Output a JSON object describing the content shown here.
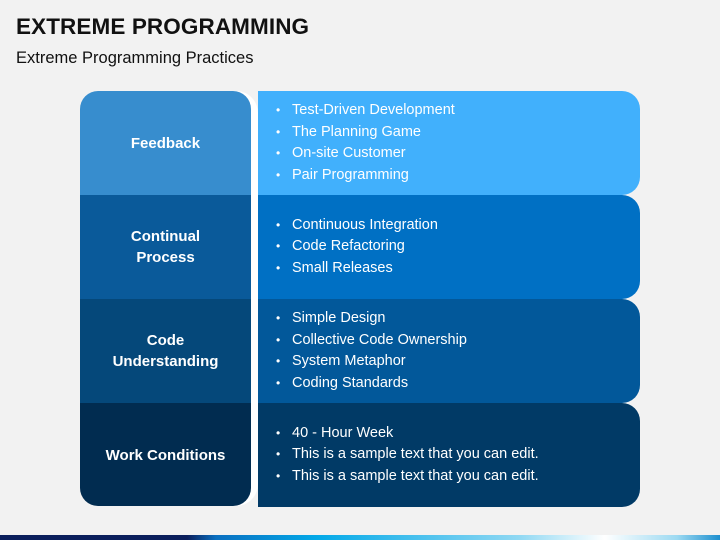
{
  "header": {
    "title": "EXTREME PROGRAMMING",
    "subtitle": "Extreme Programming Practices"
  },
  "rows": [
    {
      "label": "Feedback",
      "left_color": "#378dce",
      "right_color": "#41b0fc",
      "items": [
        "Test-Driven Development",
        "The Planning Game",
        "On-site Customer",
        "Pair Programming"
      ]
    },
    {
      "label": "Continual Process",
      "left_color": "#0a5a9a",
      "right_color": "#0070c4",
      "items": [
        "Continuous Integration",
        "Code Refactoring",
        "Small Releases"
      ]
    },
    {
      "label": "Code Understanding",
      "left_color": "#05487a",
      "right_color": "#02589a",
      "items": [
        "Simple Design",
        "Collective Code Ownership",
        "System Metaphor",
        "Coding Standards"
      ]
    },
    {
      "label": "Work Conditions",
      "left_color": "#012c50",
      "right_color": "#013a66",
      "items": [
        "40 - Hour Week",
        "This is a sample text that you can edit.",
        "This is a sample text that you can edit."
      ]
    }
  ]
}
